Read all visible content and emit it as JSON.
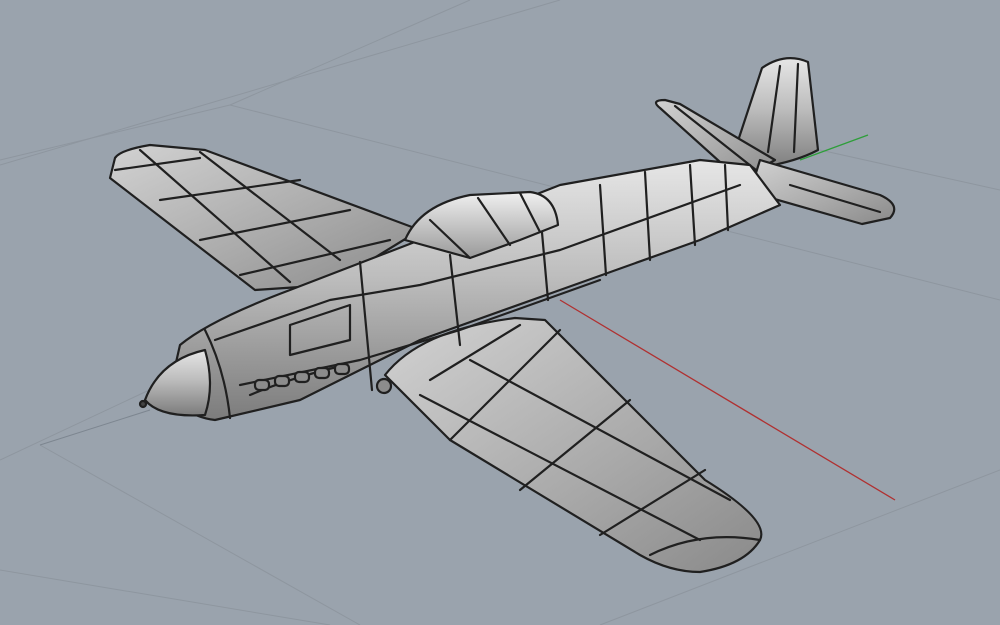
{
  "viewport": {
    "projection": "perspective",
    "display_mode": "shaded",
    "background_color": "#9aa3ad",
    "grid": true,
    "grid_color": "#8e969f",
    "axes": {
      "x_axis_color": "#b03030",
      "y_axis_color": "#2e9e3a"
    }
  },
  "model": {
    "object": "propeller-aircraft",
    "surface_color": "#bfbfbf",
    "panel_line_color": "#202020"
  }
}
